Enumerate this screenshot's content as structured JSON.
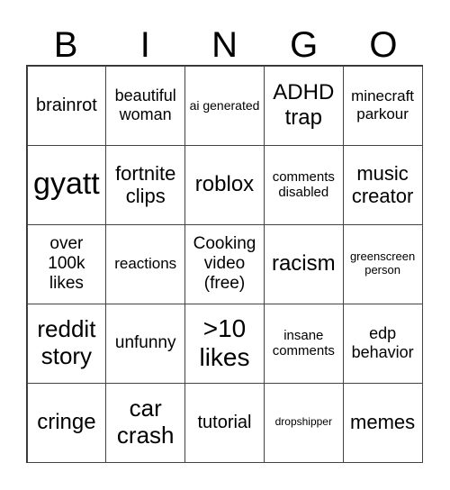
{
  "header": [
    "B",
    "I",
    "N",
    "G",
    "O"
  ],
  "cells": [
    "brainrot",
    "beautiful woman",
    "ai generated",
    "ADHD trap",
    "minecraft parkour",
    "gyatt",
    "fortnite clips",
    "roblox",
    "comments disabled",
    "music creator",
    "over 100k likes",
    "reactions",
    "Cooking video (free)",
    "racism",
    "greenscreen person",
    "reddit story",
    "unfunny",
    ">10 likes",
    "insane comments",
    "edp behavior",
    "cringe",
    "car crash",
    "tutorial",
    "dropshipper",
    "memes"
  ]
}
